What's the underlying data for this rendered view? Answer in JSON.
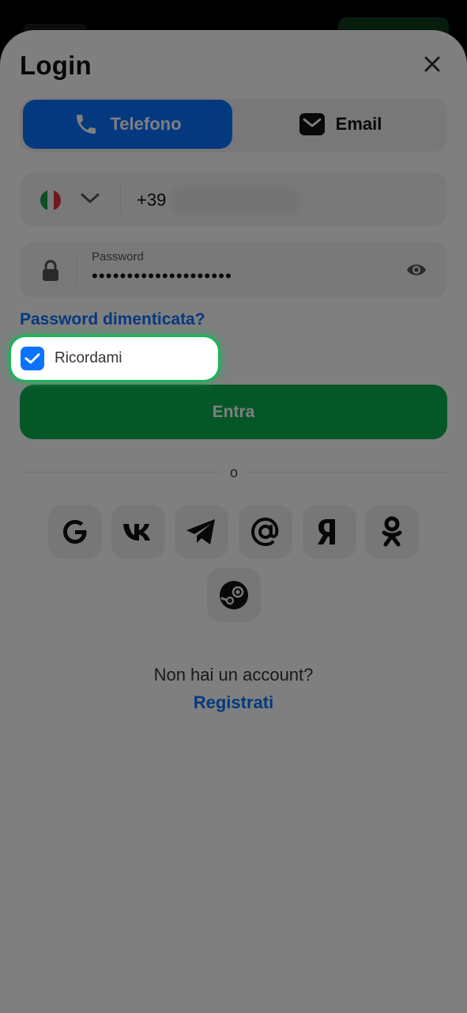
{
  "header": {
    "title": "Login",
    "close_icon": "close-icon"
  },
  "tabs": [
    {
      "label": "Telefono",
      "icon": "phone-icon",
      "active": true
    },
    {
      "label": "Email",
      "icon": "mail-icon",
      "active": false
    }
  ],
  "phone": {
    "country_flag": "italy-flag-icon",
    "prefix": "+39"
  },
  "password": {
    "label": "Password",
    "value": "••••••••••••••••••••"
  },
  "forgot_label": "Password dimenticata?",
  "remember": {
    "label": "Ricordami",
    "checked": true
  },
  "submit_label": "Entra",
  "separator_label": "o",
  "social": [
    "google-icon",
    "vk-icon",
    "telegram-icon",
    "mail-ru-icon",
    "yandex-icon",
    "odnoklassniki-icon",
    "steam-icon"
  ],
  "footer": {
    "question": "Non hai un account?",
    "register_label": "Registrati"
  },
  "colors": {
    "accent": "#0a73ff",
    "submit": "#0aae50",
    "highlight": "#1bb45a"
  }
}
